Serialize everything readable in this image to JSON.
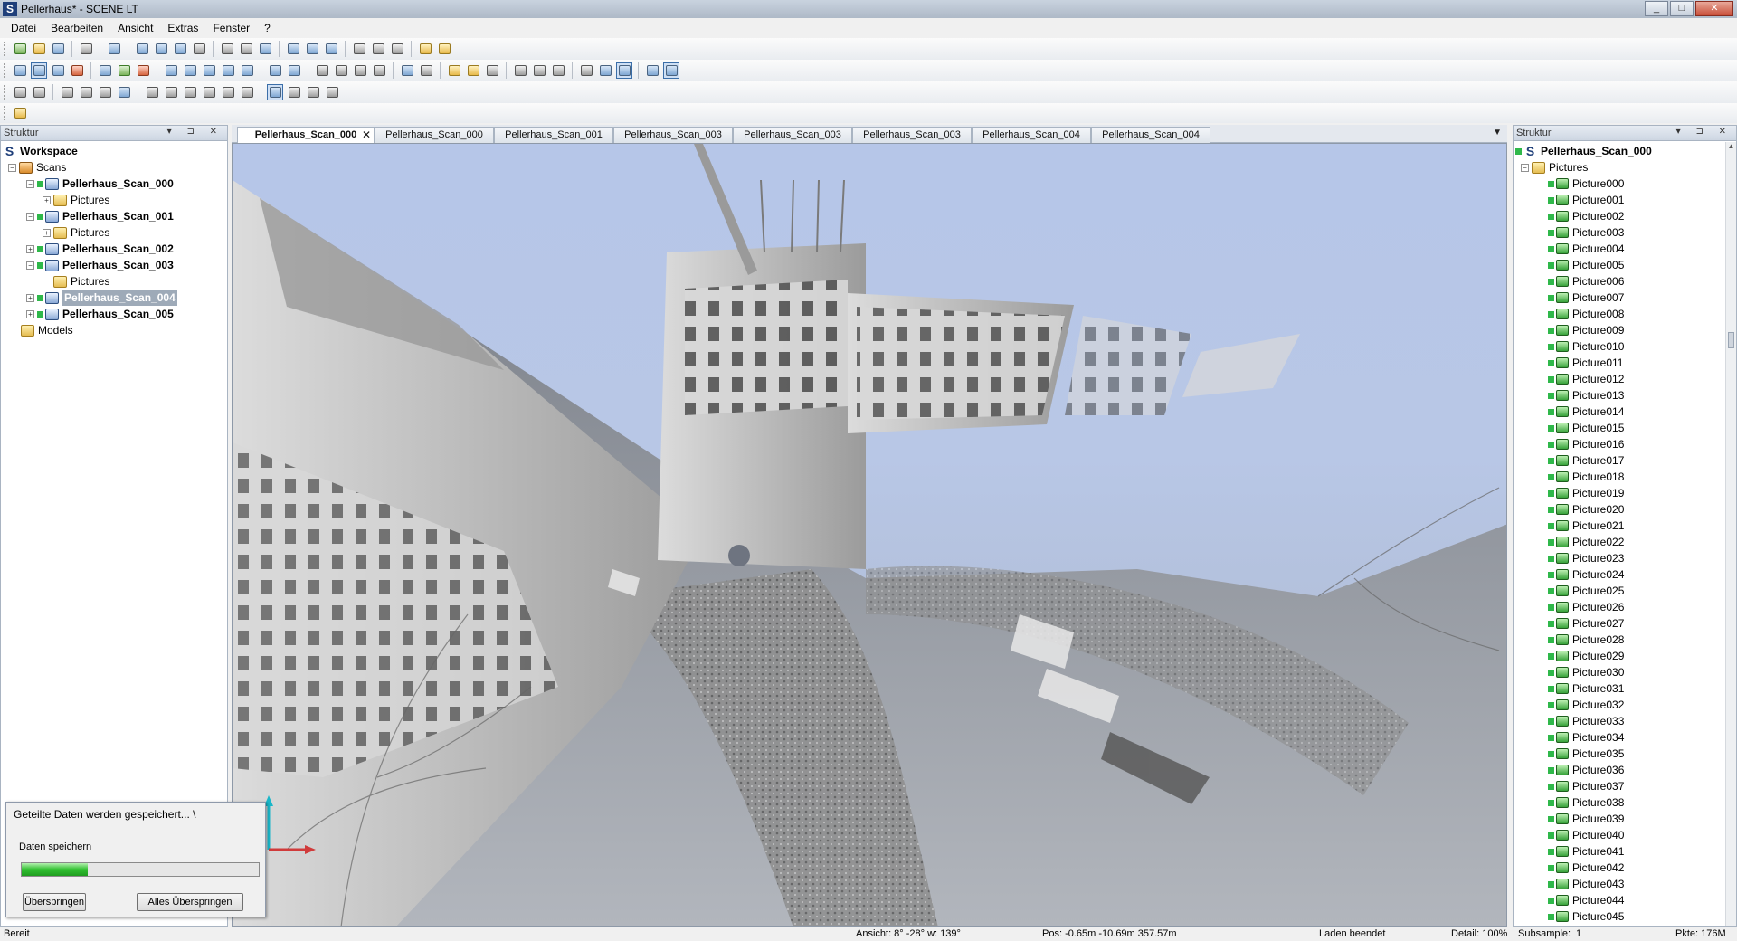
{
  "window": {
    "title": "Pellerhaus* - SCENE LT",
    "buttons": [
      "_",
      "□",
      "✕"
    ]
  },
  "menu": [
    "Datei",
    "Bearbeiten",
    "Ansicht",
    "Extras",
    "Fenster",
    "?"
  ],
  "left_panel": {
    "title": "Struktur",
    "controls": "▾ ⊐ ✕",
    "tree": {
      "workspace": "Workspace",
      "scans": "Scans",
      "items": [
        {
          "name": "Pellerhaus_Scan_000",
          "child": "Pictures"
        },
        {
          "name": "Pellerhaus_Scan_001",
          "child": "Pictures"
        },
        {
          "name": "Pellerhaus_Scan_002"
        },
        {
          "name": "Pellerhaus_Scan_003",
          "child": "Pictures"
        },
        {
          "name": "Pellerhaus_Scan_004",
          "selected": true
        },
        {
          "name": "Pellerhaus_Scan_005"
        }
      ],
      "models": "Models"
    }
  },
  "tabs": [
    "Pellerhaus_Scan_000",
    "Pellerhaus_Scan_000",
    "Pellerhaus_Scan_001",
    "Pellerhaus_Scan_003",
    "Pellerhaus_Scan_003",
    "Pellerhaus_Scan_003",
    "Pellerhaus_Scan_004",
    "Pellerhaus_Scan_004"
  ],
  "tab_close": "✕",
  "right_panel": {
    "title": "Struktur",
    "controls": "▾ ⊐ ✕",
    "root": "Pellerhaus_Scan_000",
    "folder": "Pictures",
    "pictures": [
      "Picture000",
      "Picture001",
      "Picture002",
      "Picture003",
      "Picture004",
      "Picture005",
      "Picture006",
      "Picture007",
      "Picture008",
      "Picture009",
      "Picture010",
      "Picture011",
      "Picture012",
      "Picture013",
      "Picture014",
      "Picture015",
      "Picture016",
      "Picture017",
      "Picture018",
      "Picture019",
      "Picture020",
      "Picture021",
      "Picture022",
      "Picture023",
      "Picture024",
      "Picture025",
      "Picture026",
      "Picture027",
      "Picture028",
      "Picture029",
      "Picture030",
      "Picture031",
      "Picture032",
      "Picture033",
      "Picture034",
      "Picture035",
      "Picture036",
      "Picture037",
      "Picture038",
      "Picture039",
      "Picture040",
      "Picture041",
      "Picture042",
      "Picture043",
      "Picture044",
      "Picture045"
    ]
  },
  "dialog": {
    "title": "Geteilte Daten werden gespeichert...  \\",
    "label": "Daten speichern",
    "progress": 0.28,
    "skip": "Überspringen",
    "skip_all": "Alles Überspringen"
  },
  "status": {
    "ready": "Bereit",
    "view": "Ansicht: 8° -28° w: 139°",
    "pos": "Pos: -0.65m -10.69m 357.57m",
    "load": "Laden beendet",
    "detail": "Detail: 100%",
    "subsample": "Subsample:",
    "subsample_val": "1",
    "points": "Pkte: 176M"
  },
  "colors": {
    "status_green": "#2fb84a",
    "selection": "#9eaab8",
    "sky": "#b6c6e8"
  }
}
